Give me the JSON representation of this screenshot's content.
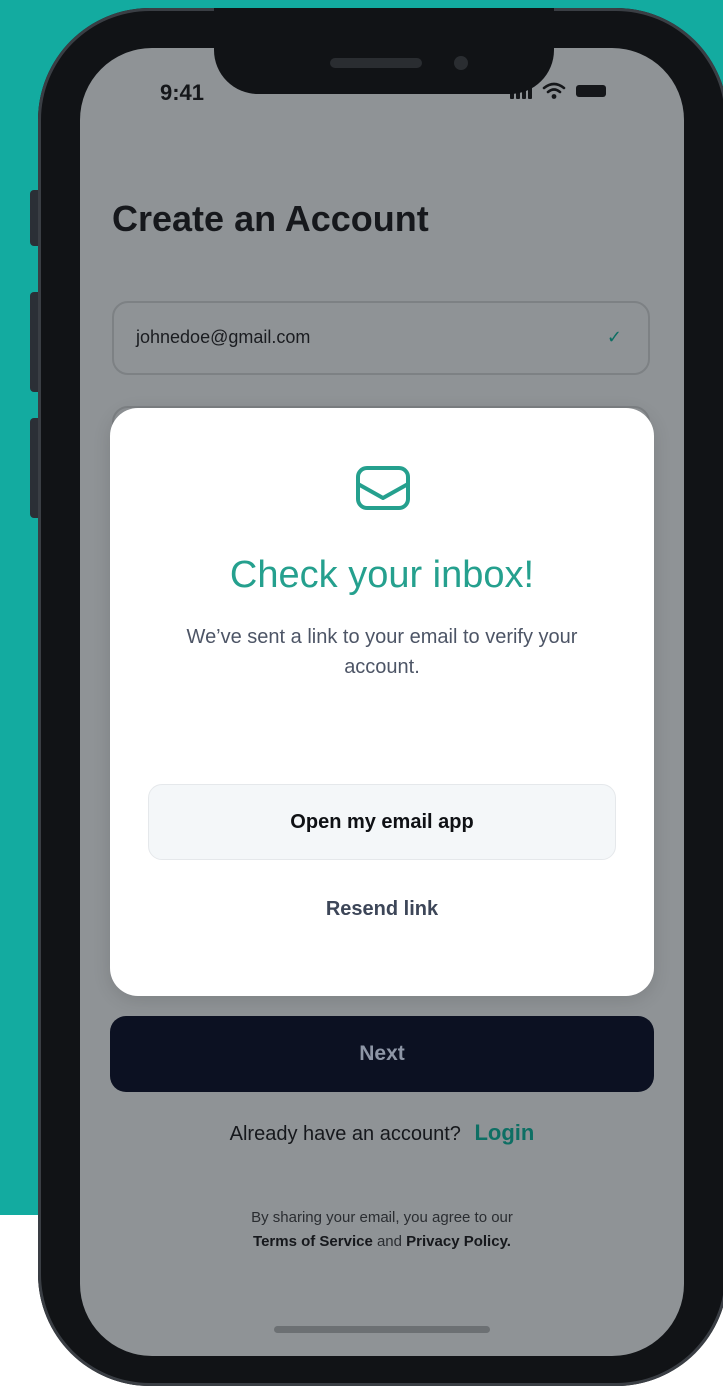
{
  "colors": {
    "background": "#13aba0",
    "accent": "#25a08e",
    "primary_button": "#0c1122",
    "link": "#0e6f64"
  },
  "status_bar": {
    "time": "9:41",
    "icons": [
      "signal-icon",
      "wifi-icon",
      "battery-icon"
    ]
  },
  "page": {
    "title": "Create an Account",
    "email_value": "johnedoe@gmail.com",
    "email_status_icon": "checkmark-icon"
  },
  "modal": {
    "icon": "envelope-icon",
    "title": "Check your inbox!",
    "message": "We’ve sent a link to your email to verify your account.",
    "primary_button": "Open my email app",
    "secondary_link": "Resend link"
  },
  "footer": {
    "next_label": "Next",
    "login_prompt": "Already have an account?",
    "login_link": "Login",
    "legal_prefix": "By sharing your email, you agree to our",
    "terms": "Terms of Service",
    "and": "and",
    "privacy": "Privacy Policy."
  }
}
